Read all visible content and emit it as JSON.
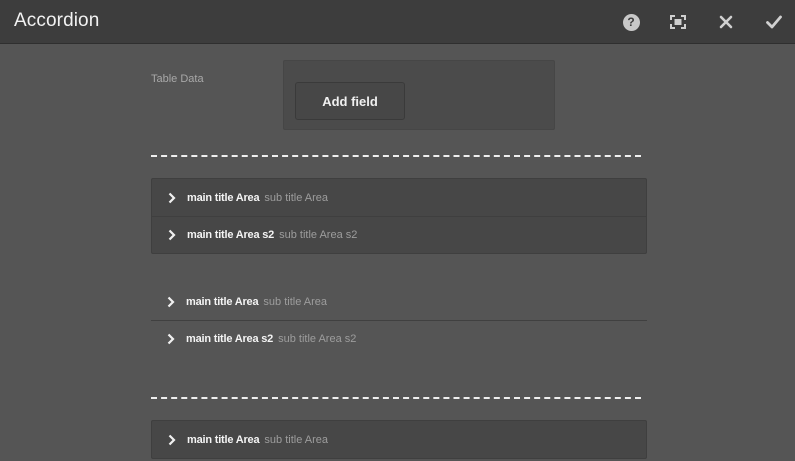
{
  "header": {
    "title": "Accordion",
    "help_glyph": "?",
    "icons": [
      "help-icon",
      "fullscreen-icon",
      "close-icon",
      "checkmark-icon"
    ]
  },
  "form": {
    "table_data_label": "Table Data",
    "add_field_label": "Add field"
  },
  "accordions": [
    {
      "style": "boxed",
      "items": [
        {
          "main": "main title Area",
          "sub": "sub title Area"
        },
        {
          "main": "main title Area s2",
          "sub": "sub title Area s2"
        }
      ]
    },
    {
      "style": "plain",
      "items": [
        {
          "main": "main title Area",
          "sub": "sub title Area"
        },
        {
          "main": "main title Area s2",
          "sub": "sub title Area s2"
        }
      ]
    },
    {
      "style": "boxed",
      "items": [
        {
          "main": "main title Area",
          "sub": "sub title Area"
        }
      ]
    }
  ],
  "colors": {
    "background": "#555555",
    "header": "#3d3d3d",
    "panel": "#474747",
    "separator": "#efefef"
  }
}
